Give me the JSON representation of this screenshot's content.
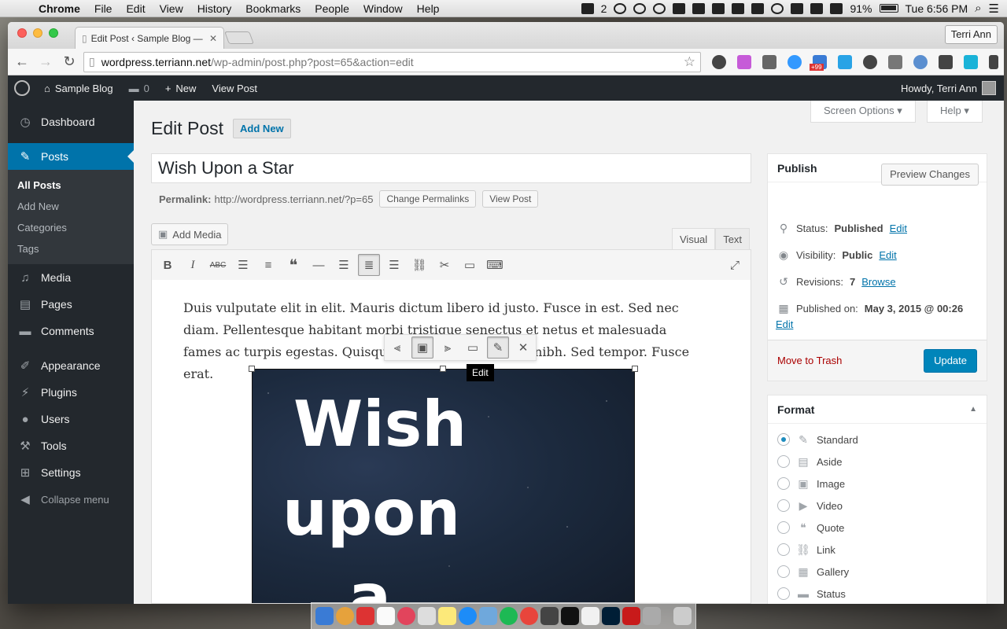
{
  "menubar": {
    "app": "Chrome",
    "items": [
      "File",
      "Edit",
      "View",
      "History",
      "Bookmarks",
      "People",
      "Window",
      "Help"
    ],
    "battery": "91%",
    "clock": "Tue 6:56 PM",
    "tray_count": "2"
  },
  "browser": {
    "tab_title": "Edit Post ‹ Sample Blog —",
    "tab_close": "✕",
    "user_button": "Terri Ann",
    "url_host": "wordpress.terriann.net",
    "url_path": "/wp-admin/post.php?post=65&action=edit",
    "badge": "+99"
  },
  "adminbar": {
    "site": "Sample Blog",
    "comments": "0",
    "new": "New",
    "view": "View Post",
    "howdy": "Howdy, Terri Ann"
  },
  "sidebar": {
    "dashboard": "Dashboard",
    "posts": "Posts",
    "sub": [
      "All Posts",
      "Add New",
      "Categories",
      "Tags"
    ],
    "media": "Media",
    "pages": "Pages",
    "comments": "Comments",
    "appearance": "Appearance",
    "plugins": "Plugins",
    "users": "Users",
    "tools": "Tools",
    "settings": "Settings",
    "collapse": "Collapse menu"
  },
  "screen_options": "Screen Options ▾",
  "help": "Help ▾",
  "heading": {
    "title": "Edit Post",
    "add_new": "Add New"
  },
  "post": {
    "title": "Wish Upon a Star",
    "permalink_label": "Permalink:",
    "permalink_url": "http://wordpress.terriann.net/?p=65",
    "change_permalinks": "Change Permalinks",
    "view_post": "View Post",
    "add_media": "Add Media",
    "tab_visual": "Visual",
    "tab_text": "Text",
    "body": "Duis vulputate elit in elit. Mauris dictum libero id justo. Fusce in est. Sed nec diam. Pellentesque habitant morbi tristique senectus et netus et malesuada fames ac turpis egestas. Quisque lorem mi, sagittis id, nibh. Sed tempor. Fusce erat.",
    "image_words": [
      "Wish",
      "upon",
      "a"
    ],
    "tooltip": "Edit"
  },
  "publish": {
    "header": "Publish",
    "preview": "Preview Changes",
    "status_label": "Status:",
    "status_value": "Published",
    "visibility_label": "Visibility:",
    "visibility_value": "Public",
    "revisions_label": "Revisions:",
    "revisions_value": "7",
    "browse": "Browse",
    "published_label": "Published on:",
    "published_value": "May 3, 2015 @ 00:26",
    "edit": "Edit",
    "trash": "Move to Trash",
    "update": "Update"
  },
  "format": {
    "header": "Format",
    "options": [
      "Standard",
      "Aside",
      "Image",
      "Video",
      "Quote",
      "Link",
      "Gallery",
      "Status"
    ],
    "selected": "Standard"
  },
  "colors": {
    "wp_blue": "#0073aa",
    "admin_dark": "#23282d",
    "update_btn": "#0085ba",
    "trash": "#a00"
  }
}
